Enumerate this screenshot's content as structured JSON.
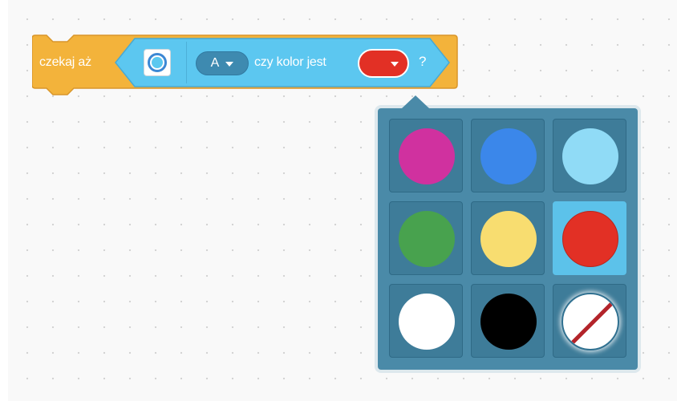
{
  "block": {
    "label": "czekaj aż",
    "port": "A",
    "question": "czy kolor jest",
    "qmark": "?",
    "selected_color": "#e23025"
  },
  "colors": {
    "block_orange": "#f3b33b",
    "hex_blue": "#5cc7f0",
    "palette_bg": "#4a8aa8",
    "selected_highlight": "#5cc2ea"
  },
  "palette": {
    "swatches": [
      {
        "name": "magenta",
        "color": "#d0319f"
      },
      {
        "name": "blue",
        "color": "#3b87ea"
      },
      {
        "name": "light-blue",
        "color": "#90dbf6"
      },
      {
        "name": "green",
        "color": "#48a24e"
      },
      {
        "name": "yellow",
        "color": "#f8dd70"
      },
      {
        "name": "red",
        "color": "#e23025",
        "selected": true
      },
      {
        "name": "white",
        "color": "#ffffff"
      },
      {
        "name": "black",
        "color": "#000000"
      },
      {
        "name": "no-color",
        "icon": "no-color-icon"
      }
    ]
  }
}
